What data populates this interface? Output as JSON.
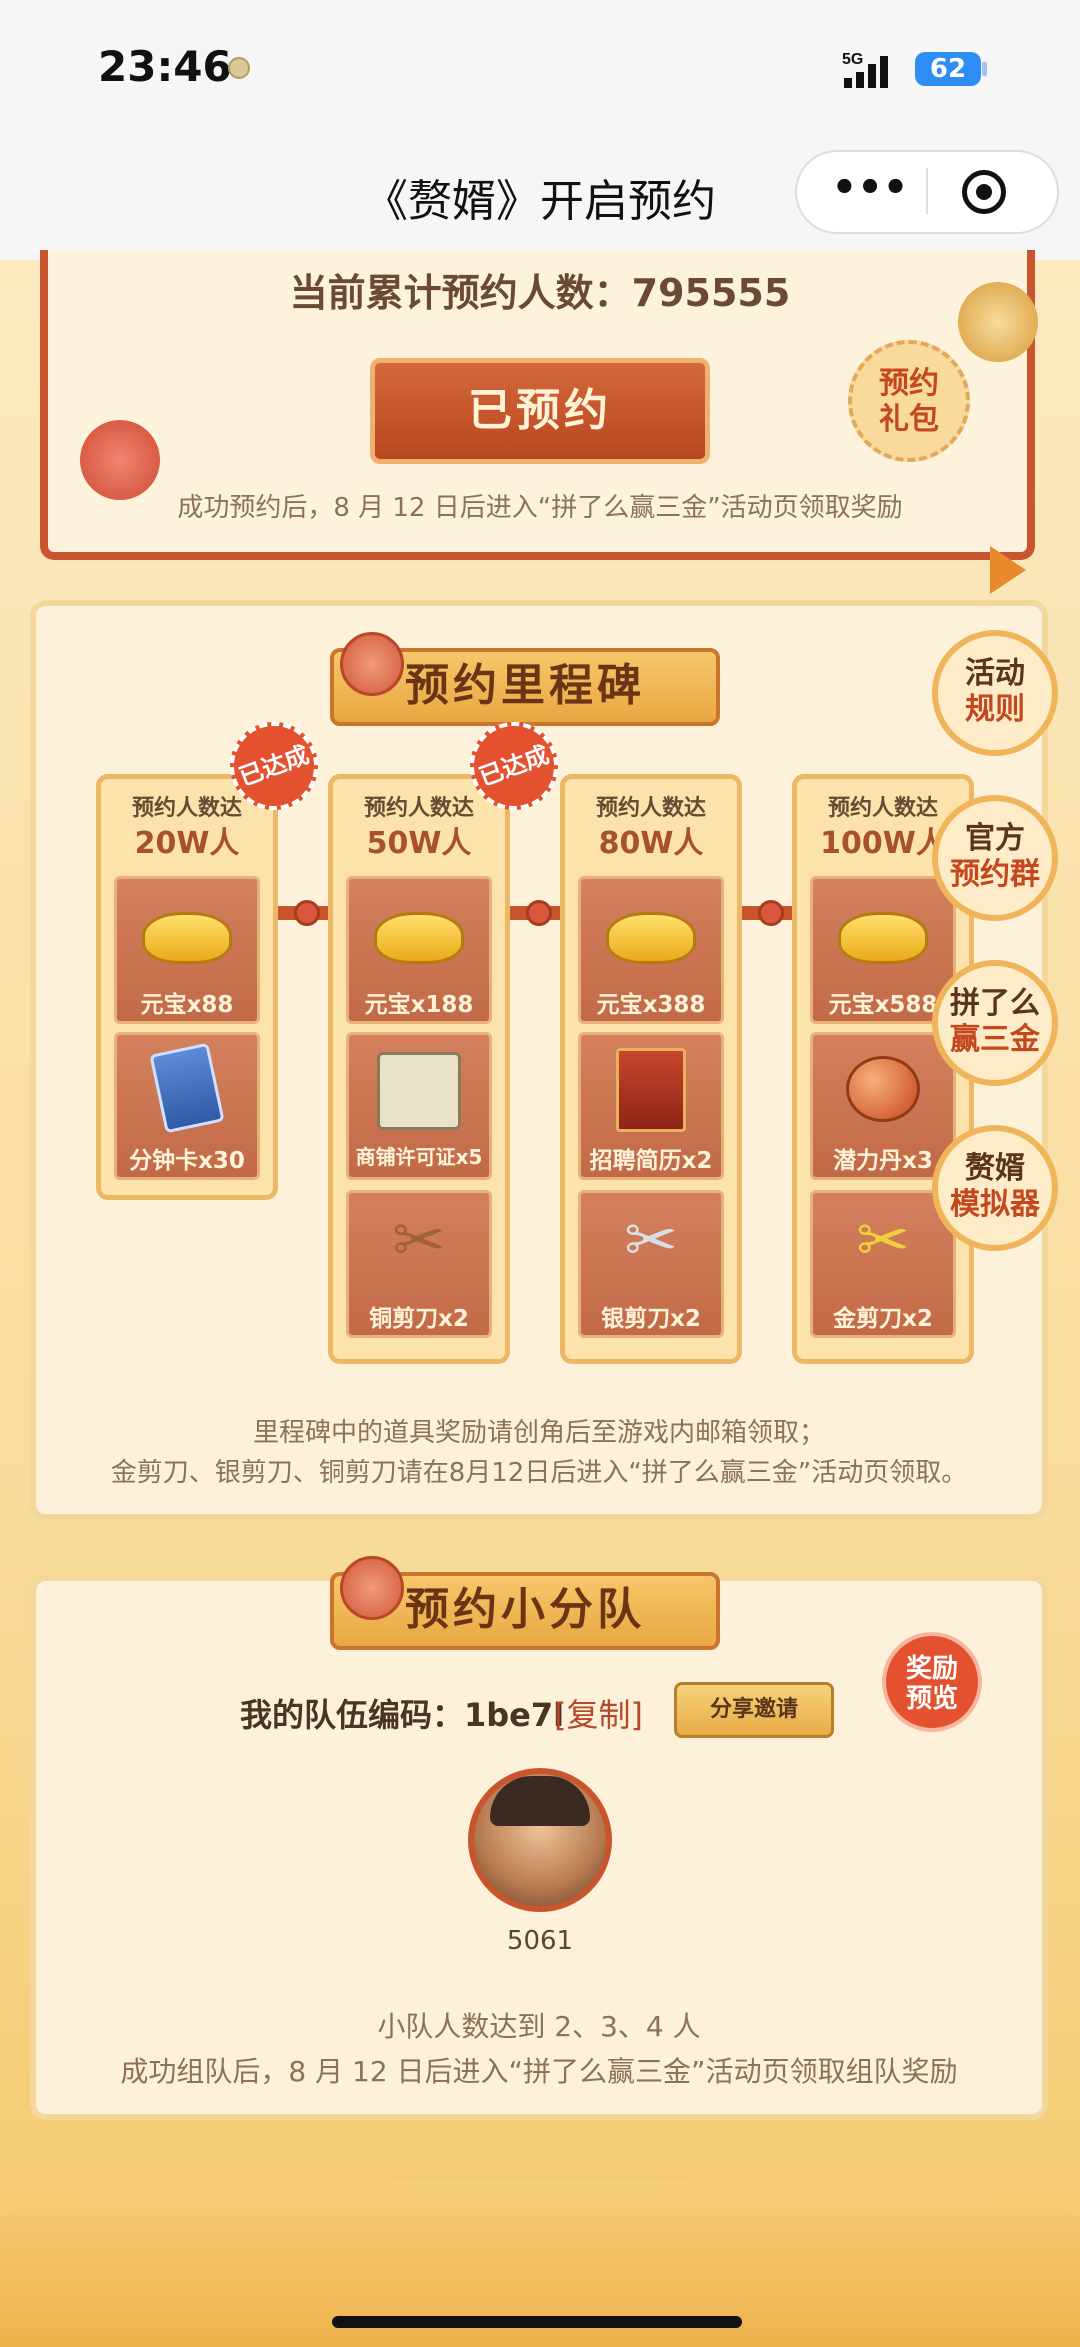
{
  "status_bar": {
    "time": "23:46",
    "network": "5G",
    "battery": "62"
  },
  "nav": {
    "title": "《赘婿》开启预约",
    "more_icon": "more-dots-icon",
    "close_icon": "target-circle-icon"
  },
  "reserve": {
    "count_label": "当前累计预约人数：795555",
    "button_label": "已预约",
    "gift_badge": "预约礼包",
    "notice": "成功预约后，8 月 12 日后进入“拼了么赢三金”活动页领取奖励"
  },
  "milestone": {
    "title": "预约里程碑",
    "done_badge": "已达成",
    "columns": [
      {
        "head1": "预约人数达",
        "head2": "20W人",
        "done": true,
        "items": [
          {
            "label": "元宝x88",
            "icon": "gold-ingot-icon"
          },
          {
            "label": "分钟卡x30",
            "icon": "hourglass-card-icon"
          }
        ]
      },
      {
        "head1": "预约人数达",
        "head2": "50W人",
        "done": true,
        "items": [
          {
            "label": "元宝x188",
            "icon": "gold-ingot-icon"
          },
          {
            "label": "商铺许可证x5",
            "icon": "license-icon"
          },
          {
            "label": "铜剪刀x2",
            "icon": "bronze-scissors-icon"
          }
        ]
      },
      {
        "head1": "预约人数达",
        "head2": "80W人",
        "done": false,
        "items": [
          {
            "label": "元宝x388",
            "icon": "gold-ingot-icon"
          },
          {
            "label": "招聘简历x2",
            "icon": "resume-book-icon"
          },
          {
            "label": "银剪刀x2",
            "icon": "silver-scissors-icon"
          }
        ]
      },
      {
        "head1": "预约人数达",
        "head2": "100W人",
        "done": false,
        "items": [
          {
            "label": "元宝x588",
            "icon": "gold-ingot-icon"
          },
          {
            "label": "潜力丹x3",
            "icon": "potential-pill-icon"
          },
          {
            "label": "金剪刀x2",
            "icon": "gold-scissors-icon"
          }
        ]
      }
    ],
    "notice_line1": "里程碑中的道具奖励请创角后至游戏内邮箱领取；",
    "notice_line2": "金剪刀、银剪刀、铜剪刀请在8月12日后进入“拼了么赢三金”活动页领取。"
  },
  "side_buttons": [
    {
      "l1": "活动",
      "l2": "规则"
    },
    {
      "l1": "官方",
      "l2": "预约群"
    },
    {
      "l1": "拼了么",
      "l2": "赢三金"
    },
    {
      "l1": "赘婿",
      "l2": "模拟器"
    }
  ],
  "squad": {
    "title": "预约小分队",
    "team_code_label": "我的队伍编码：1be7l",
    "copy_label": "[复制]",
    "share_label": "分享邀请",
    "reward_preview": "奖励预览",
    "member_id": "5061",
    "line1": "小队人数达到 2、3、4 人",
    "line2": "成功组队后，8 月 12 日后进入“拼了么赢三金”活动页领取组队奖励"
  },
  "colors": {
    "accent": "#c9552e",
    "gold": "#e9a742",
    "text_brown": "#6b4a33"
  }
}
